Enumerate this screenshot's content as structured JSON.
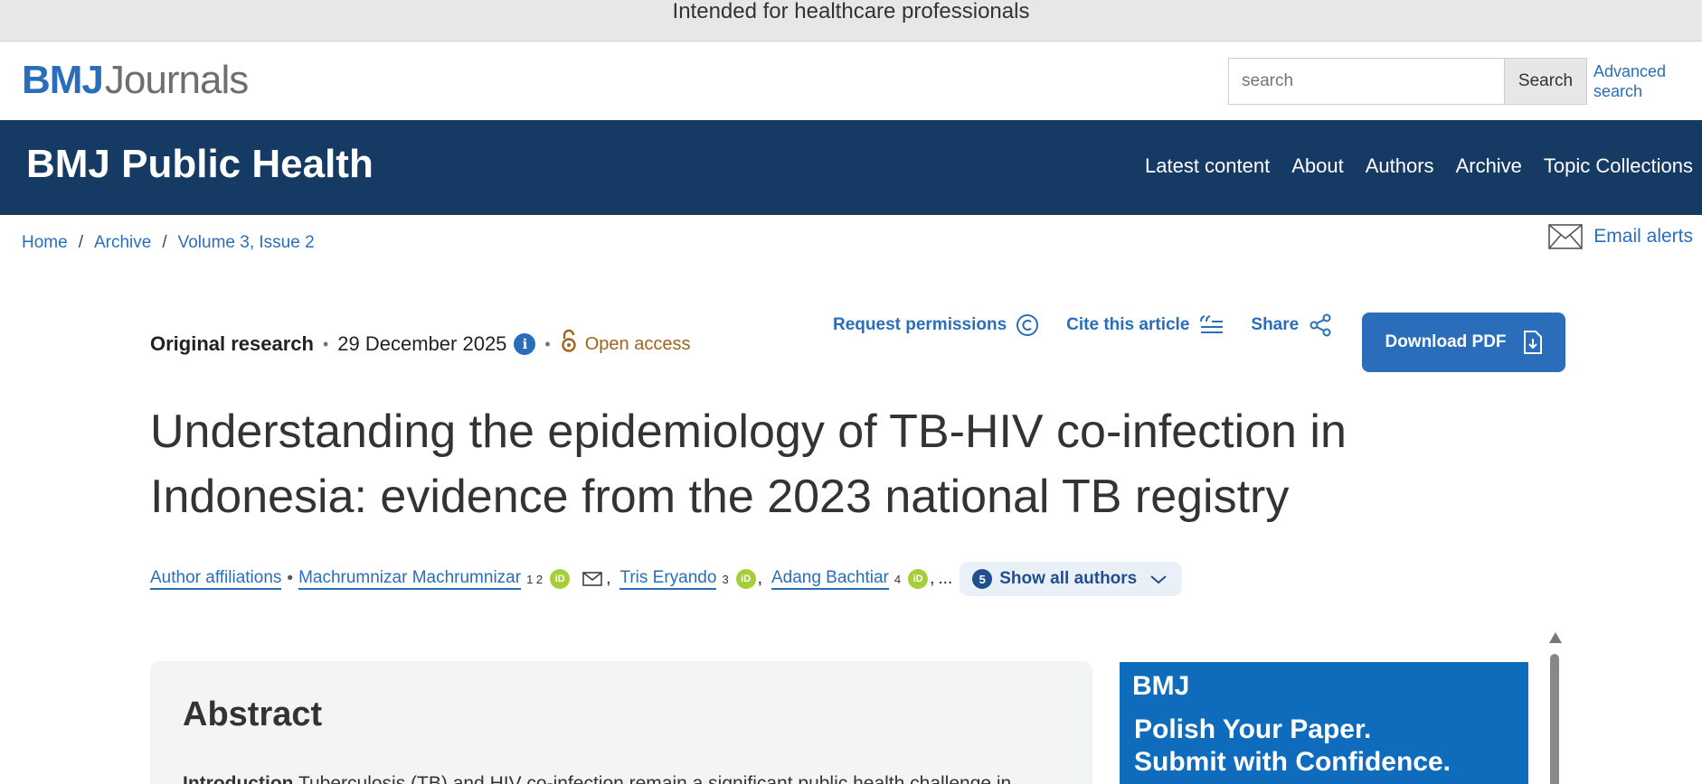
{
  "banner": {
    "text": "Intended for healthcare professionals"
  },
  "header": {
    "logo_bmj": "BMJ",
    "logo_journals": "Journals",
    "search_placeholder": "search",
    "search_button": "Search",
    "advanced_search": "Advanced search"
  },
  "journal": {
    "title": "BMJ Public Health",
    "nav": [
      "Latest content",
      "About",
      "Authors",
      "Archive",
      "Topic Collections"
    ]
  },
  "breadcrumb": {
    "items": [
      "Home",
      "Archive",
      "Volume 3, Issue 2"
    ],
    "separator": "/"
  },
  "email_alerts": "Email alerts",
  "article": {
    "type": "Original research",
    "dot": "•",
    "date": "29 December 2025",
    "info_glyph": "i",
    "access": "Open access",
    "actions": {
      "request_permissions": "Request permissions",
      "cite": "Cite this article",
      "share": "Share",
      "download_pdf": "Download PDF"
    },
    "title": "Understanding the epidemiology of TB-HIV co-infection in Indonesia: evidence from the 2023 national TB registry",
    "authors": {
      "affiliations_link": "Author affiliations",
      "bullet": "•",
      "list": [
        {
          "name": "Machrumnizar Machrumnizar",
          "sup": "1 2"
        },
        {
          "name": "Tris Eryando",
          "sup": "3"
        },
        {
          "name": "Adang Bachtiar",
          "sup": "4"
        }
      ],
      "comma": ",",
      "ellipsis": "...",
      "orcid_glyph": "iD",
      "show_all_count": "5",
      "show_all_label": "Show all authors"
    }
  },
  "abstract": {
    "heading": "Abstract",
    "intro_label": "Introduction",
    "intro_text": " Tuberculosis (TB) and HIV co-infection remain a significant public health challenge in"
  },
  "ad": {
    "logo": "BMJ",
    "line1": "Polish Your Paper.",
    "line2": "Submit with Confidence."
  },
  "colors": {
    "brand_blue": "#2a6ebb",
    "journal_bar": "#153a63",
    "open_access": "#a0631d",
    "orcid_green": "#a6ce39"
  }
}
